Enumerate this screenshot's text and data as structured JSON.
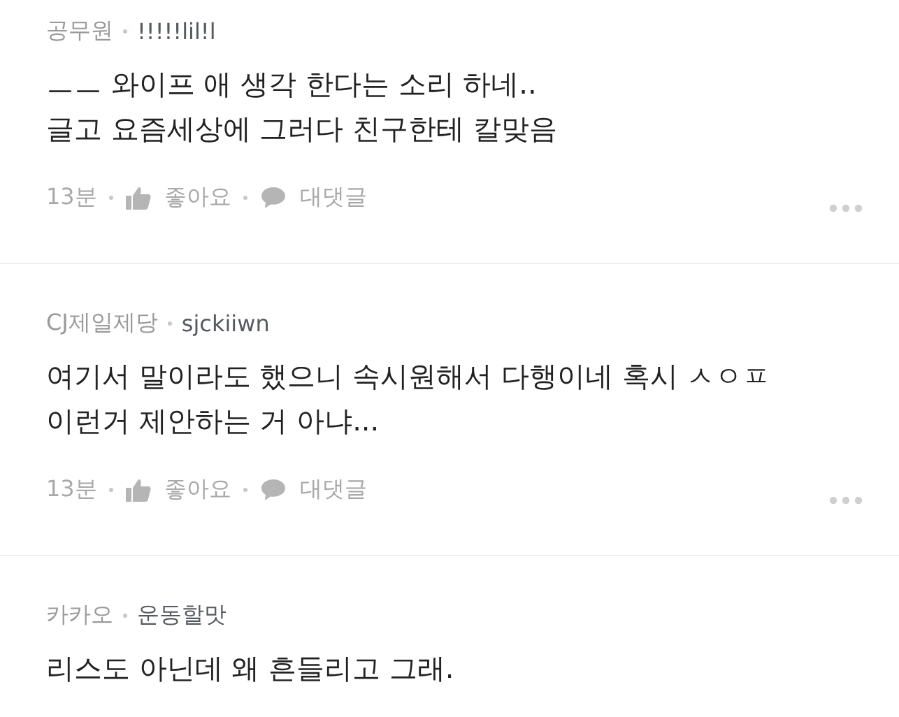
{
  "comments": [
    {
      "company": "공무원",
      "nickname": "!!!!!lil!l",
      "lines": [
        "ㅡㅡ 와이프 애 생각 한다는 소리 하네..",
        "글고 요즘세상에 그러다 친구한테 칼맞음"
      ],
      "time": "13분",
      "like_label": "좋아요",
      "reply_label": "대댓글"
    },
    {
      "company": "CJ제일제당",
      "nickname": "sjckiiwn",
      "lines": [
        "여기서 말이라도 했으니 속시원해서 다행이네 혹시 ㅅㅇㅍ",
        "이런거 제안하는 거 아냐..."
      ],
      "time": "13분",
      "like_label": "좋아요",
      "reply_label": "대댓글"
    },
    {
      "company": "카카오",
      "nickname": "운동할맛",
      "lines": [
        "리스도 아닌데 왜 흔들리고 그래."
      ]
    }
  ]
}
